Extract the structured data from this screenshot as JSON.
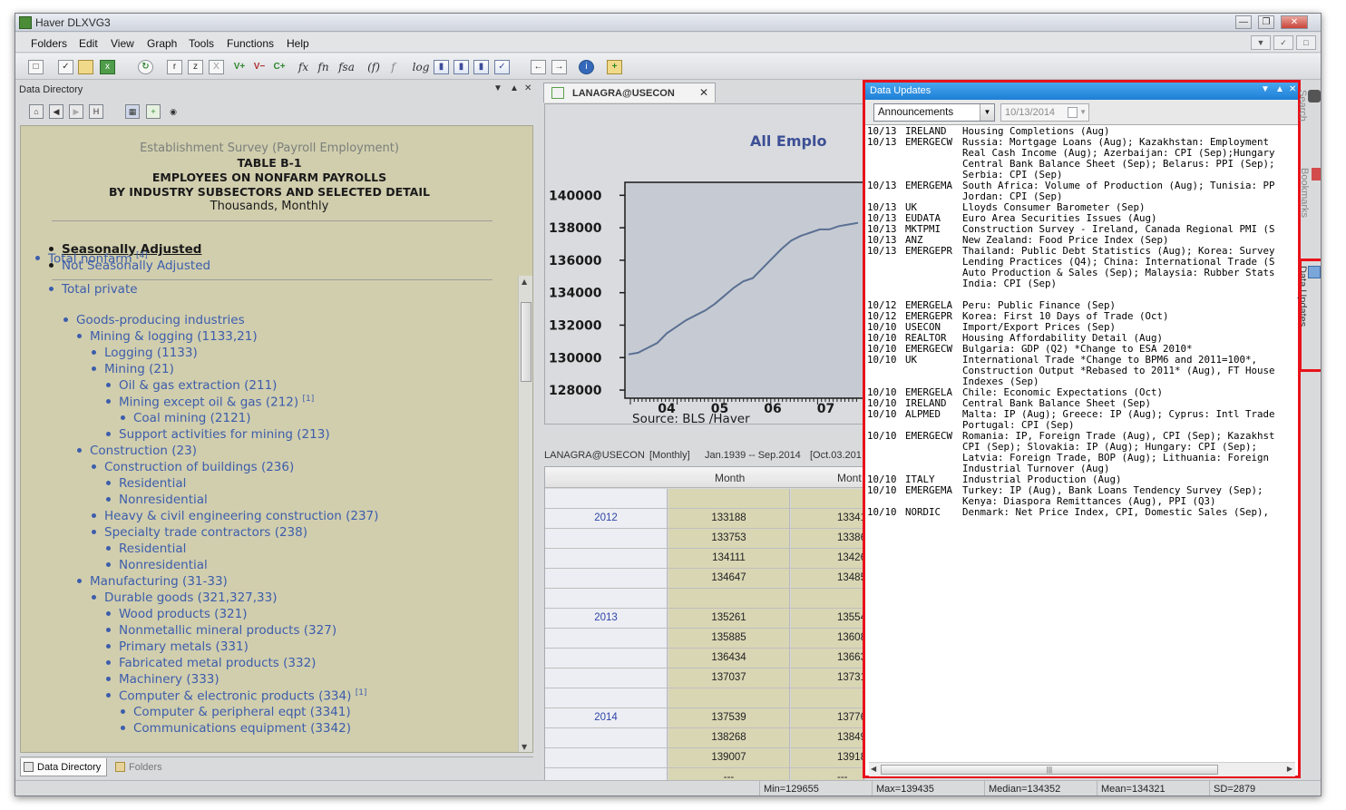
{
  "window": {
    "title": "Haver DLXVG3"
  },
  "menu": [
    "Folders",
    "Edit",
    "View",
    "Graph",
    "Tools",
    "Functions",
    "Help"
  ],
  "toolbar": {
    "r": "r",
    "z": "z",
    "x": "X",
    "vplus": "V+",
    "vminus": "V−",
    "cplus": "C+",
    "fx": "fx",
    "fn": "fn",
    "fsa": "fsa",
    "f_paren": "(f)",
    "f_strike": "f",
    "log": "log"
  },
  "left_pane": {
    "title": "Data Directory",
    "survey": "Establishment Survey (Payroll Employment)",
    "table_id": "TABLE B-1",
    "table_title": "EMPLOYEES ON NONFARM PAYROLLS",
    "table_subtitle": "BY INDUSTRY SUBSECTORS AND SELECTED DETAIL",
    "units": "Thousands, Monthly",
    "sa": "Seasonally Adjusted",
    "nsa": "Not Seasonally Adjusted",
    "tree": [
      {
        "label": "Total nonfarm",
        "sup": "[4]"
      },
      {
        "label": "Total private",
        "sup": ""
      },
      {
        "label": "Goods-producing industries",
        "sup": ""
      },
      {
        "label": "Mining & logging (1133,21)",
        "sup": ""
      },
      {
        "label": "Logging (1133)",
        "sup": ""
      },
      {
        "label": "Mining (21)",
        "sup": ""
      },
      {
        "label": "Oil & gas extraction (211)",
        "sup": ""
      },
      {
        "label": "Mining except oil & gas (212)",
        "sup": "[1]"
      },
      {
        "label": "Coal mining (2121)",
        "sup": ""
      },
      {
        "label": "Support activities for mining (213)",
        "sup": ""
      },
      {
        "label": "Construction (23)",
        "sup": ""
      },
      {
        "label": "Construction of buildings (236)",
        "sup": ""
      },
      {
        "label": "Residential",
        "sup": ""
      },
      {
        "label": "Nonresidential",
        "sup": ""
      },
      {
        "label": "Heavy & civil engineering construction (237)",
        "sup": ""
      },
      {
        "label": "Specialty trade contractors (238)",
        "sup": ""
      },
      {
        "label": "Residential",
        "sup": ""
      },
      {
        "label": "Nonresidential",
        "sup": ""
      },
      {
        "label": "Manufacturing (31-33)",
        "sup": ""
      },
      {
        "label": "Durable goods (321,327,33)",
        "sup": ""
      },
      {
        "label": "Wood products (321)",
        "sup": ""
      },
      {
        "label": "Nonmetallic mineral products (327)",
        "sup": ""
      },
      {
        "label": "Primary metals (331)",
        "sup": ""
      },
      {
        "label": "Fabricated metal products (332)",
        "sup": ""
      },
      {
        "label": "Machinery (333)",
        "sup": ""
      },
      {
        "label": "Computer & electronic products (334)",
        "sup": "[1]"
      },
      {
        "label": "Computer & peripheral eqpt (3341)",
        "sup": ""
      },
      {
        "label": "Communications equipment (3342)",
        "sup": ""
      }
    ],
    "tab_directory": "Data Directory",
    "tab_folders": "Folders"
  },
  "middle_pane": {
    "tab": "LANAGRA@USECON",
    "chart_title": "All Emplo",
    "source": "Source:  BLS /Haver",
    "series_info": [
      "LANAGRA@USECON",
      "[Monthly]",
      "Jan.1939 -- Sep.2014",
      "[Oct.03.201"
    ],
    "grid_headers": [
      "Month",
      "Mont"
    ],
    "grid_rows": [
      {
        "year": "",
        "v1": "",
        "v2": ""
      },
      {
        "year": "2012",
        "v1": "133188",
        "v2": "13341"
      },
      {
        "year": "",
        "v1": "133753",
        "v2": "13386"
      },
      {
        "year": "",
        "v1": "134111",
        "v2": "13426"
      },
      {
        "year": "",
        "v1": "134647",
        "v2": "13485"
      },
      {
        "year": "",
        "v1": "",
        "v2": ""
      },
      {
        "year": "2013",
        "v1": "135261",
        "v2": "13554"
      },
      {
        "year": "",
        "v1": "135885",
        "v2": "13608"
      },
      {
        "year": "",
        "v1": "136434",
        "v2": "13663"
      },
      {
        "year": "",
        "v1": "137037",
        "v2": "13731"
      },
      {
        "year": "",
        "v1": "",
        "v2": ""
      },
      {
        "year": "2014",
        "v1": "137539",
        "v2": "13776"
      },
      {
        "year": "",
        "v1": "138268",
        "v2": "13849"
      },
      {
        "year": "",
        "v1": "139007",
        "v2": "13918"
      },
      {
        "year": "",
        "v1": "---",
        "v2": "---"
      }
    ]
  },
  "chart_data": {
    "type": "line",
    "title": "All Emplo",
    "ylim": [
      127500,
      140800
    ],
    "yticks": [
      "140000",
      "138000",
      "136000",
      "134000",
      "132000",
      "130000",
      "128000"
    ],
    "xticks": [
      "04",
      "05",
      "06",
      "07"
    ],
    "x": [
      2003.0,
      2003.2,
      2003.4,
      2003.6,
      2003.8,
      2004.0,
      2004.2,
      2004.4,
      2004.6,
      2004.8,
      2005.0,
      2005.2,
      2005.4,
      2005.6,
      2005.8,
      2006.0,
      2006.2,
      2006.4,
      2006.6,
      2006.8,
      2007.0,
      2007.2,
      2007.4,
      2007.6,
      2007.8
    ],
    "values": [
      130200,
      130300,
      130600,
      130900,
      131500,
      131900,
      132300,
      132600,
      132900,
      133300,
      133800,
      134300,
      134700,
      134900,
      135500,
      136100,
      136700,
      137200,
      137500,
      137700,
      137900,
      137900,
      138100,
      138200,
      138300
    ],
    "source": "Source:  BLS /Haver"
  },
  "updates": {
    "title": "Data Updates",
    "filter": "Announcements",
    "date": "10/13/2014",
    "lines": [
      {
        "d": "10/13",
        "s": "IRELAND",
        "t": "Housing Completions (Aug)"
      },
      {
        "d": "10/13",
        "s": "EMERGECW",
        "t": "Russia: Mortgage Loans (Aug); Kazakhstan: Employment"
      },
      {
        "d": "",
        "s": "",
        "t": "Real Cash Income (Aug); Azerbaijan: CPI (Sep);Hungary"
      },
      {
        "d": "",
        "s": "",
        "t": "Central Bank Balance Sheet (Sep); Belarus: PPI (Sep);"
      },
      {
        "d": "",
        "s": "",
        "t": "Serbia: CPI (Sep)"
      },
      {
        "d": "10/13",
        "s": "EMERGEMA",
        "t": "South Africa: Volume of Production (Aug); Tunisia: PP"
      },
      {
        "d": "",
        "s": "",
        "t": "Jordan: CPI (Sep)"
      },
      {
        "d": "10/13",
        "s": "UK",
        "t": "Lloyds Consumer Barometer (Sep)"
      },
      {
        "d": "10/13",
        "s": "EUDATA",
        "t": "Euro Area Securities Issues (Aug)"
      },
      {
        "d": "10/13",
        "s": "MKTPMI",
        "t": "Construction Survey - Ireland, Canada Regional PMI (S"
      },
      {
        "d": "10/13",
        "s": "ANZ",
        "t": "New Zealand: Food Price Index (Sep)"
      },
      {
        "d": "10/13",
        "s": "EMERGEPR",
        "t": "Thailand: Public Debt Statistics (Aug); Korea: Survey"
      },
      {
        "d": "",
        "s": "",
        "t": "Lending Practices (Q4); China: International Trade (S"
      },
      {
        "d": "",
        "s": "",
        "t": "Auto Production & Sales (Sep); Malaysia: Rubber Stats"
      },
      {
        "d": "",
        "s": "",
        "t": "India: CPI (Sep)"
      },
      {
        "d": "",
        "s": "",
        "t": ""
      },
      {
        "d": "10/12",
        "s": "EMERGELA",
        "t": "Peru: Public Finance (Sep)"
      },
      {
        "d": "10/12",
        "s": "EMERGEPR",
        "t": "Korea: First 10 Days of Trade (Oct)"
      },
      {
        "d": "10/10",
        "s": "USECON",
        "t": "Import/Export Prices (Sep)"
      },
      {
        "d": "10/10",
        "s": "REALTOR",
        "t": "Housing Affordability Detail (Aug)"
      },
      {
        "d": "10/10",
        "s": "EMERGECW",
        "t": "Bulgaria: GDP (Q2) *Change to ESA 2010*"
      },
      {
        "d": "10/10",
        "s": "UK",
        "t": "International Trade *Change to BPM6 and 2011=100*,"
      },
      {
        "d": "",
        "s": "",
        "t": "Construction Output *Rebased to 2011* (Aug), FT House"
      },
      {
        "d": "",
        "s": "",
        "t": "Indexes (Sep)"
      },
      {
        "d": "10/10",
        "s": "EMERGELA",
        "t": "Chile: Economic Expectations (Oct)"
      },
      {
        "d": "10/10",
        "s": "IRELAND",
        "t": "Central Bank Balance Sheet (Sep)"
      },
      {
        "d": "10/10",
        "s": "ALPMED",
        "t": "Malta: IP (Aug); Greece: IP (Aug); Cyprus: Intl Trade"
      },
      {
        "d": "",
        "s": "",
        "t": "Portugal: CPI (Sep)"
      },
      {
        "d": "10/10",
        "s": "EMERGECW",
        "t": "Romania: IP, Foreign Trade (Aug), CPI (Sep); Kazakhst"
      },
      {
        "d": "",
        "s": "",
        "t": "CPI (Sep); Slovakia: IP (Aug); Hungary: CPI (Sep);"
      },
      {
        "d": "",
        "s": "",
        "t": "Latvia: Foreign Trade, BOP (Aug); Lithuania: Foreign"
      },
      {
        "d": "",
        "s": "",
        "t": "Industrial Turnover (Aug)"
      },
      {
        "d": "10/10",
        "s": "ITALY",
        "t": "Industrial Production (Aug)"
      },
      {
        "d": "10/10",
        "s": "EMERGEMA",
        "t": "Turkey: IP (Aug), Bank Loans Tendency Survey (Sep);"
      },
      {
        "d": "",
        "s": "",
        "t": "Kenya: Diaspora Remittances (Aug), PPI (Q3)"
      },
      {
        "d": "10/10",
        "s": "NORDIC",
        "t": "Denmark: Net Price Index, CPI, Domestic Sales (Sep),"
      }
    ]
  },
  "side_tabs": {
    "search": "Search",
    "bookmarks": "Bookmarks",
    "data_updates": "Data Updates"
  },
  "status": {
    "min": "Min=129655",
    "max": "Max=139435",
    "median": "Median=134352",
    "mean": "Mean=134321",
    "sd": "SD=2879"
  }
}
